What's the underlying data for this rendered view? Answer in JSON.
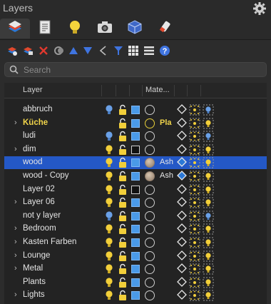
{
  "panel": {
    "title": "Layers"
  },
  "tabs": [
    {
      "icon": "layers-tab-icon"
    },
    {
      "icon": "pages-tab-icon"
    },
    {
      "icon": "lights-tab-icon"
    },
    {
      "icon": "camera-tab-icon"
    },
    {
      "icon": "cube-tab-icon"
    },
    {
      "icon": "paint-tab-icon"
    }
  ],
  "toolbar": [
    "new-layer-icon",
    "new-layer-folder-icon",
    "delete-layer-icon",
    "merge-icon",
    "move-up-icon",
    "move-down-icon",
    "collapse-icon",
    "filter-icon",
    "grid-icon",
    "list-icon",
    "help-icon"
  ],
  "search": {
    "placeholder": "Search"
  },
  "header": {
    "layer": "Layer",
    "material": "Mate..."
  },
  "colors": {
    "accent": "#2458c6",
    "bulb": "#f2cf3a",
    "bulb_off": "#6aa0e6",
    "square": "#4a9ae8",
    "highlight": "#f0d44a"
  },
  "rows": [
    {
      "name": "abbruch",
      "chevron": false,
      "bulb": "off",
      "square": "blue",
      "circle": "empty",
      "material": "",
      "selected": false,
      "hl": false
    },
    {
      "name": "Küche",
      "chevron": true,
      "bulb": "none",
      "square": "blue",
      "circle": "yellow",
      "material": "Pla",
      "selected": false,
      "hl": true
    },
    {
      "name": "ludi",
      "chevron": false,
      "bulb": "off",
      "square": "blue",
      "circle": "empty",
      "material": "",
      "selected": false,
      "hl": false
    },
    {
      "name": "dim",
      "chevron": true,
      "bulb": "on",
      "square": "black",
      "circle": "empty",
      "material": "",
      "selected": false,
      "hl": false
    },
    {
      "name": "wood",
      "chevron": false,
      "bulb": "on",
      "square": "blue",
      "circle": "fill",
      "material": "Ash",
      "selected": true,
      "hl": false
    },
    {
      "name": "wood - Copy",
      "chevron": false,
      "bulb": "on",
      "square": "blue",
      "circle": "fill",
      "material": "Ash",
      "selected": false,
      "hl": false
    },
    {
      "name": "Layer 02",
      "chevron": false,
      "bulb": "on",
      "square": "black",
      "circle": "empty",
      "material": "",
      "selected": false,
      "hl": false
    },
    {
      "name": "Layer 06",
      "chevron": true,
      "bulb": "on",
      "square": "blue",
      "circle": "empty",
      "material": "",
      "selected": false,
      "hl": false
    },
    {
      "name": "not y layer",
      "chevron": false,
      "bulb": "off",
      "square": "blue",
      "circle": "empty",
      "material": "",
      "selected": false,
      "hl": false
    },
    {
      "name": "Bedroom",
      "chevron": true,
      "bulb": "on",
      "square": "blue",
      "circle": "empty",
      "material": "",
      "selected": false,
      "hl": false
    },
    {
      "name": "Kasten Farben",
      "chevron": true,
      "bulb": "on",
      "square": "blue",
      "circle": "empty",
      "material": "",
      "selected": false,
      "hl": false
    },
    {
      "name": "Lounge",
      "chevron": true,
      "bulb": "on",
      "square": "blue",
      "circle": "empty",
      "material": "",
      "selected": false,
      "hl": false
    },
    {
      "name": "Metal",
      "chevron": true,
      "bulb": "on",
      "square": "blue",
      "circle": "empty",
      "material": "",
      "selected": false,
      "hl": false
    },
    {
      "name": "Plants",
      "chevron": false,
      "bulb": "on",
      "square": "blue",
      "circle": "empty",
      "material": "",
      "selected": false,
      "hl": false
    },
    {
      "name": "Lights",
      "chevron": true,
      "bulb": "on",
      "square": "blue",
      "circle": "empty",
      "material": "",
      "selected": false,
      "hl": false
    }
  ]
}
